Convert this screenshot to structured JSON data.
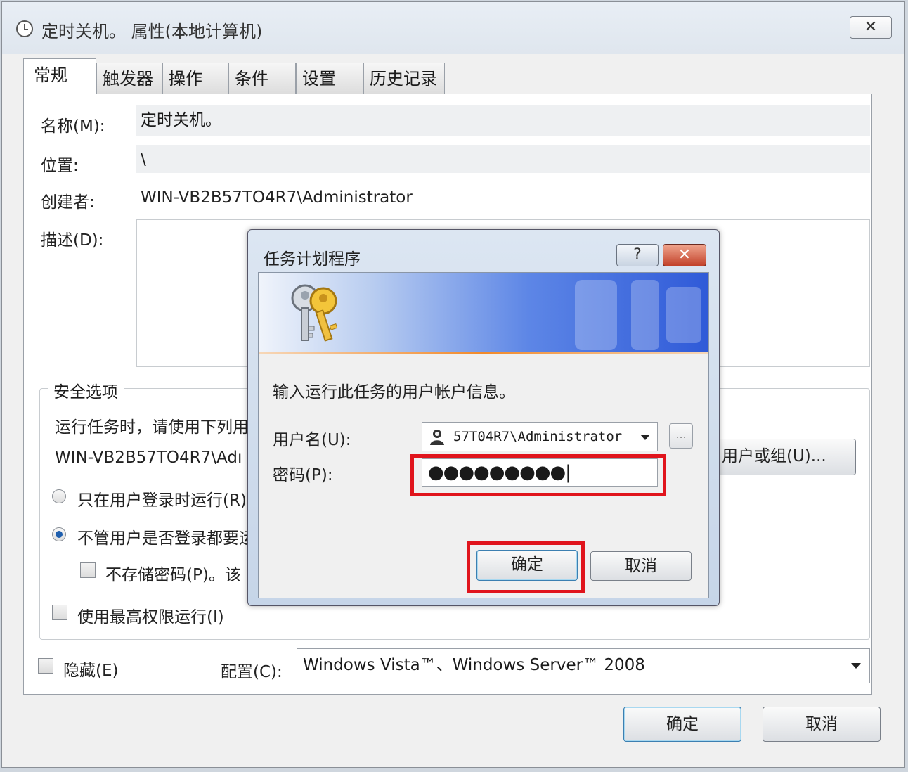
{
  "window": {
    "title": "定时关机。 属性(本地计算机)",
    "close_label": "✕"
  },
  "tabs": [
    "常规",
    "触发器",
    "操作",
    "条件",
    "设置",
    "历史记录"
  ],
  "general": {
    "name_label": "名称(M):",
    "name_value": "定时关机。",
    "location_label": "位置:",
    "location_value": "\\",
    "author_label": "创建者:",
    "author_value": "WIN-VB2B57TO4R7\\Administrator",
    "description_label": "描述(D):"
  },
  "security": {
    "group_title": "安全选项",
    "run_as_text": "运行任务时，请使用下列用",
    "account_value": "WIN-VB2B57TO4R7\\Adı",
    "change_user_button": "用户或组(U)...",
    "radio_logged_on": "只在用户登录时运行(R)",
    "radio_whether_logged": "不管用户是否登录都要运",
    "no_store_password": "不存储密码(P)。该",
    "highest_privileges": "使用最高权限运行(I)",
    "radio_selected": "whether_logged"
  },
  "bottom": {
    "hidden_label": "隐藏(E)",
    "config_label": "配置(C):",
    "config_value": "Windows Vista™、Windows Server™ 2008",
    "ok_button": "确定",
    "cancel_button": "取消"
  },
  "dialog": {
    "title": "任务计划程序",
    "help_label": "?",
    "close_label": "✕",
    "prompt": "输入运行此任务的用户帐户信息。",
    "username_label": "用户名(U):",
    "username_value": "57T04R7\\Administrator",
    "browse_label": "...",
    "password_label": "密码(P):",
    "password_value": "●●●●●●●●●|",
    "ok_button": "确定",
    "cancel_button": "取消",
    "highlight_color": "#e0141c"
  }
}
